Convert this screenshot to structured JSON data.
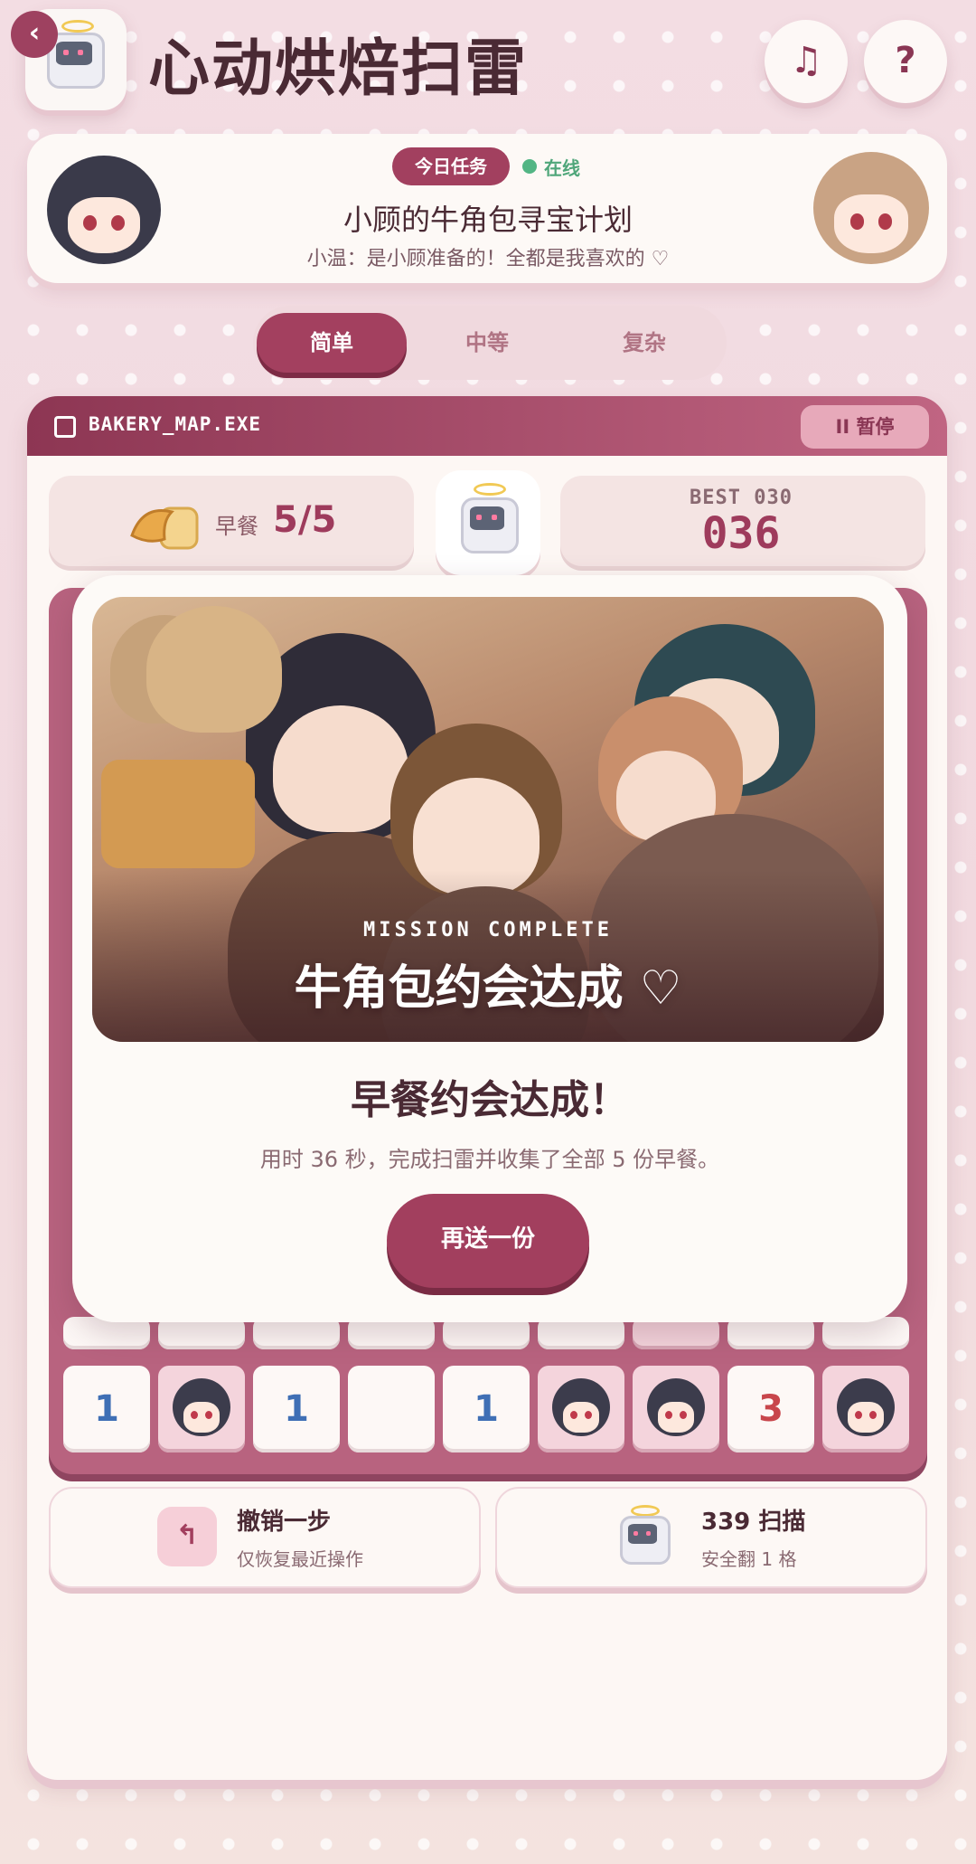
{
  "header": {
    "app_title": "心动烘焙扫雷",
    "back_icon": "‹",
    "music_icon": "♫",
    "help_icon": "?"
  },
  "mission": {
    "badge": "今日任务",
    "status": "在线",
    "title": "小顾的牛角包寻宝计划",
    "subtitle": "小温：是小顾准备的！全都是我喜欢的 ♡"
  },
  "difficulty": {
    "tabs": [
      "简单",
      "中等",
      "复杂"
    ],
    "active": "简单"
  },
  "game_window": {
    "title": "BAKERY_MAP.EXE",
    "pause_label": "II 暂停",
    "breakfast_label": "早餐",
    "breakfast_count": "5/5",
    "best_label": "BEST 030",
    "best_value": "036"
  },
  "board": {
    "partial_row": [
      "",
      "",
      "",
      "",
      "",
      "",
      "",
      "",
      ""
    ],
    "last_row": [
      "1",
      "face",
      "1",
      "",
      "1",
      "face",
      "face",
      "3",
      "face"
    ]
  },
  "modal": {
    "illustration_tag": "MISSION COMPLETE",
    "illustration_title": "牛角包约会达成 ♡",
    "title": "早餐约会达成！",
    "description": "用时 36 秒，完成扫雷并收集了全部 5 份早餐。",
    "replay_button": "再送一份"
  },
  "actions": {
    "undo_title": "撤销一步",
    "undo_sub": "仅恢复最近操作",
    "scan_title": "339 扫描",
    "scan_sub": "安全翻 1 格"
  },
  "colors": {
    "accent": "#a3405f",
    "number_blue": "#3f6fb5",
    "number_red": "#c8464c",
    "online": "#52b584"
  }
}
